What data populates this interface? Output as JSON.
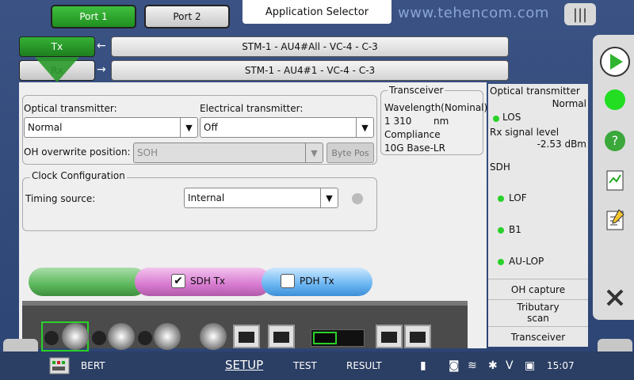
{
  "header": {
    "port1": "Port 1",
    "port2": "Port 2",
    "app_selector": "Application Selector",
    "watermark": "www.tehencom.com"
  },
  "direction": {
    "tx_label": "Tx",
    "rx_label": "Rx",
    "tx_path": "STM-1 - AU4#All - VC-4 - C-3",
    "rx_path": "STM-1 - AU4#1 - VC-4 - C-3",
    "tx_arrow": "←",
    "rx_arrow": "→"
  },
  "transmitter": {
    "optical_label": "Optical transmitter:",
    "optical_value": "Normal",
    "electrical_label": "Electrical transmitter:",
    "electrical_value": "Off",
    "oh_label": "OH overwrite position:",
    "oh_value": "SOH",
    "byte_pos": "Byte Pos"
  },
  "clock": {
    "title": "Clock Configuration",
    "timing_label": "Timing source:",
    "timing_value": "Internal"
  },
  "transceiver": {
    "title": "Transceiver",
    "wavelength_label": "Wavelength(Nominal)",
    "wavelength_value": "1 310",
    "wavelength_unit": "nm",
    "compliance_label": "Compliance",
    "compliance_value": "10G Base-LR"
  },
  "status": {
    "optical_tx_label": "Optical transmitter",
    "optical_tx_value": "Normal",
    "los": "LOS",
    "rx_level_label": "Rx signal level",
    "rx_level_value": "-2.53 dBm",
    "sdh_label": "SDH",
    "lof": "LOF",
    "b1": "B1",
    "au_lop": "AU-LOP",
    "oh_capture": "OH capture",
    "tributary_scan_1": "Tributary",
    "tributary_scan_2": "scan",
    "transceiver_btn": "Transceiver",
    "led_color": "#29d129"
  },
  "layers": {
    "sdh_tx": "SDH Tx",
    "pdh_tx": "PDH Tx",
    "sdh_checked": true,
    "pdh_checked": false
  },
  "bottom": {
    "app_name": "BERT",
    "setup": "SETUP",
    "test": "TEST",
    "result": "RESULT",
    "time": "15:07"
  }
}
